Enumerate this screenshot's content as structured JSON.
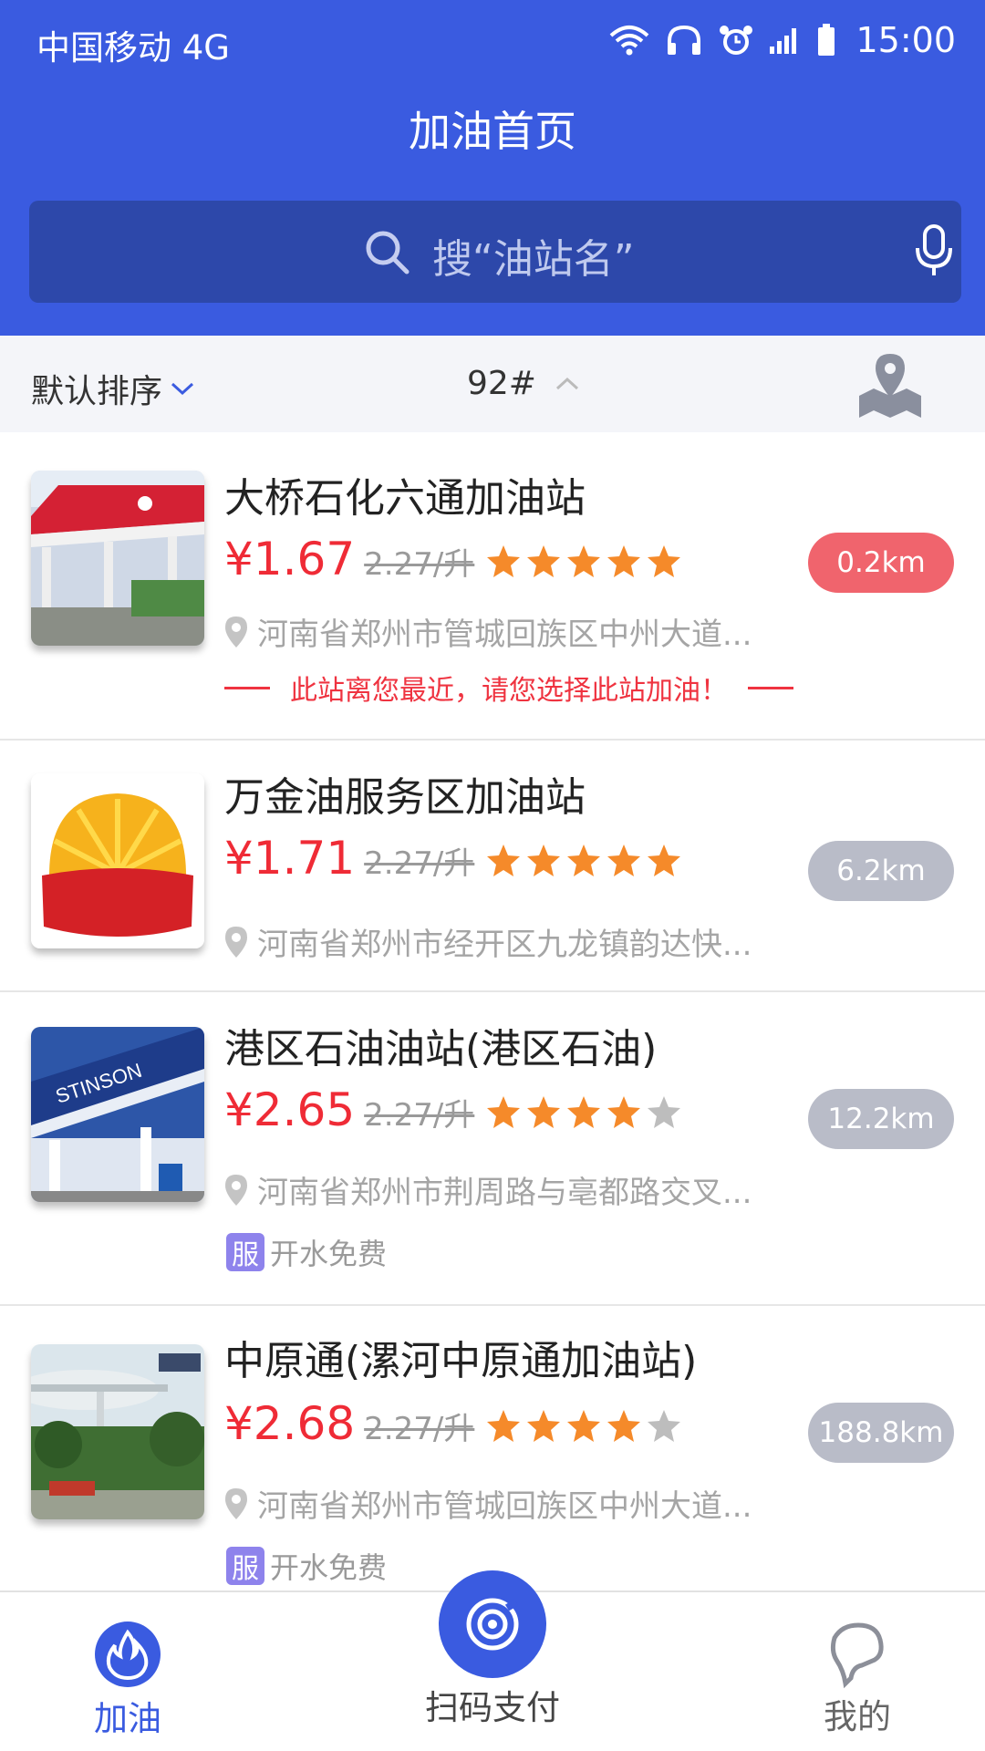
{
  "status_bar": {
    "carrier": "中国移动 4G",
    "time": "15:00",
    "icons": [
      "wifi-icon",
      "headphones-icon",
      "alarm-icon",
      "signal-icon",
      "battery-icon"
    ]
  },
  "header": {
    "title": "加油首页",
    "search_placeholder": "搜“油站名”",
    "search_icon": "search-icon",
    "mic_icon": "microphone-icon"
  },
  "sort_bar": {
    "default_sort": "默认排序",
    "fuel_type": "92#",
    "map_icon": "map-pin-icon"
  },
  "stations": [
    {
      "name": "大桥石化六通加油站",
      "price": "¥1.67",
      "original_price": "2.27/升",
      "rating": 5,
      "distance": "0.2km",
      "address": "河南省郑州市管城回族区中州大道...",
      "tip": "此站离您最近，请您选择此站加油！"
    },
    {
      "name": "万金油服务区加油站",
      "price": "¥1.71",
      "original_price": "2.27/升",
      "rating": 5,
      "distance": "6.2km",
      "address": "河南省郑州市经开区九龙镇韵达快..."
    },
    {
      "name": "港区石油油站(港区石油)",
      "price": "¥2.65",
      "original_price": "2.27/升",
      "rating": 4,
      "distance": "12.2km",
      "address": "河南省郑州市荆周路与亳都路交叉...",
      "service_badge": "服",
      "service": "开水免费"
    },
    {
      "name": "中原通(漯河中原通加油站)",
      "price": "¥2.68",
      "original_price": "2.27/升",
      "rating": 4,
      "distance": "188.8km",
      "address": "河南省郑州市管城回族区中州大道...",
      "service_badge": "服",
      "service": "开水免费"
    }
  ],
  "bottom_nav": {
    "refuel": "加油",
    "scan_pay": "扫码支付",
    "mine": "我的"
  },
  "colors": {
    "primary": "#3a5be0",
    "price_red": "#ef2b36",
    "star_orange": "#f58a2a",
    "star_gray": "#bdbdbd",
    "badge_near": "#f0646d",
    "badge_far": "#b9bcc8",
    "service_badge": "#8e83ec"
  }
}
